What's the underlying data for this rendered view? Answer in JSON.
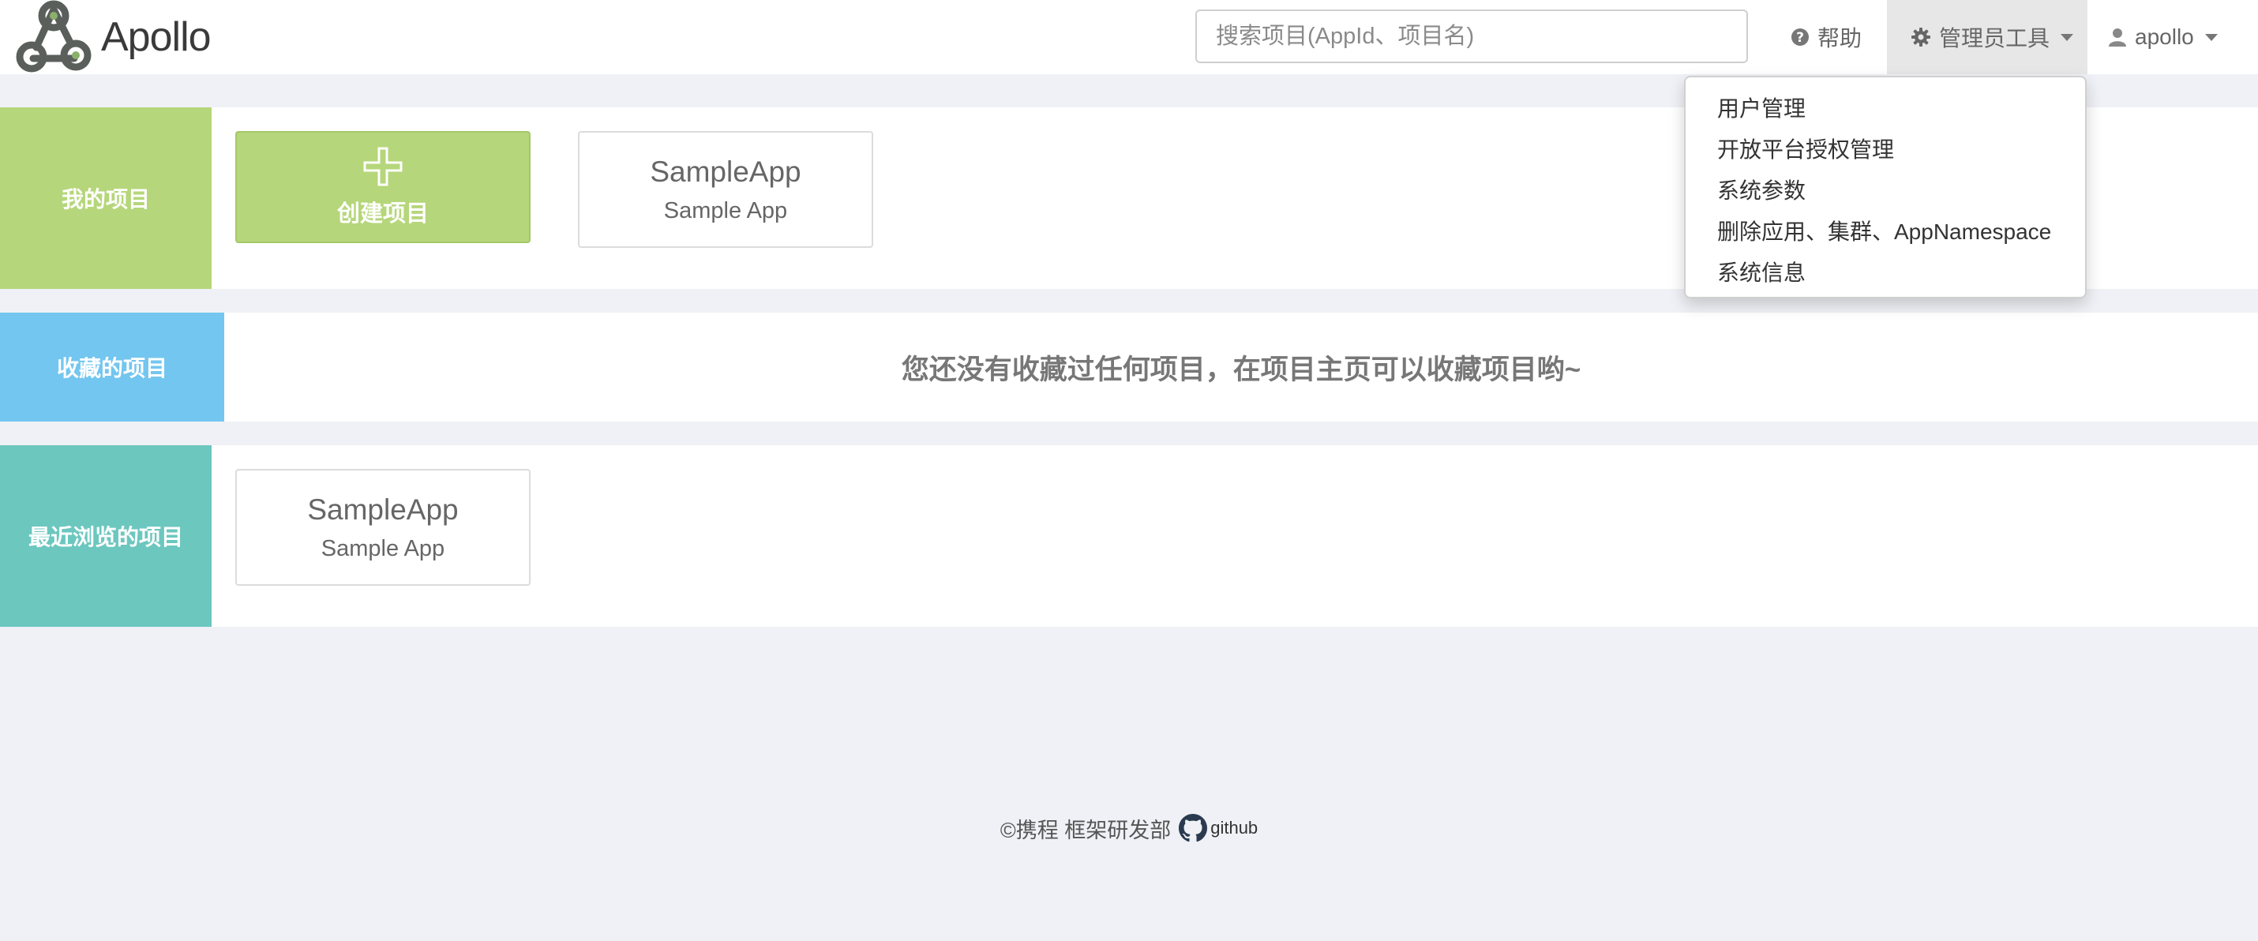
{
  "brand": {
    "name": "Apollo"
  },
  "search": {
    "placeholder": "搜索项目(AppId、项目名)"
  },
  "nav": {
    "help_label": "帮助",
    "admin_label": "管理员工具",
    "user_label": "apollo"
  },
  "admin_menu": {
    "items": [
      {
        "label": "用户管理"
      },
      {
        "label": "开放平台授权管理"
      },
      {
        "label": "系统参数"
      },
      {
        "label": "删除应用、集群、AppNamespace"
      },
      {
        "label": "系统信息"
      }
    ]
  },
  "sections": {
    "mine": {
      "label": "我的项目",
      "create_label": "创建项目",
      "apps": [
        {
          "app_id": "SampleApp",
          "name": "Sample App"
        }
      ]
    },
    "favorites": {
      "label": "收藏的项目",
      "empty_message": "您还没有收藏过任何项目，在项目主页可以收藏项目哟~"
    },
    "recent": {
      "label": "最近浏览的项目",
      "apps": [
        {
          "app_id": "SampleApp",
          "name": "Sample App"
        }
      ]
    }
  },
  "footer": {
    "copyright": "©携程 框架研发部",
    "github_label": "github"
  },
  "colors": {
    "mine_accent": "#b5d67a",
    "favorites_accent": "#73c6ef",
    "recent_accent": "#6cc7bf",
    "page_background": "#f0f1f6"
  }
}
